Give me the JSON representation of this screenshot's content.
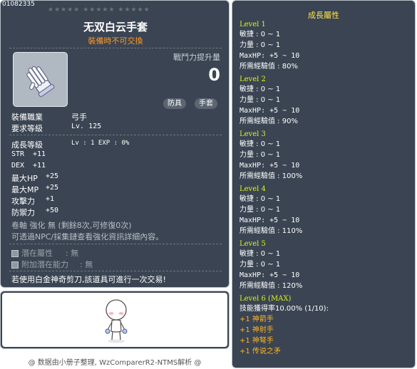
{
  "item": {
    "code": "01082335",
    "stars": "★★★★★ ★★★★★ ★★★★★",
    "name": "无双白云手套",
    "trade_note": "裝備時不可交換",
    "power_label": "戰鬥力提升量",
    "power_value": "0",
    "tags": [
      "防具",
      "手套"
    ],
    "icon": "white-glove-icon",
    "job_label": "裝備職業",
    "job_value": "弓手",
    "req_level_label": "要求等級",
    "req_level_value": "Lv. 125",
    "growth_label": "成長等級",
    "growth_value": "Lv : 1  EXP : 0%",
    "stats": [
      {
        "label": "STR",
        "value": "+11"
      },
      {
        "label": "DEX",
        "value": "+11"
      },
      {
        "label": "最大HP",
        "value": "+25"
      },
      {
        "label": "最大MP",
        "value": "+25"
      },
      {
        "label": "攻擊力",
        "value": "+1"
      },
      {
        "label": "防禦力",
        "value": "+50"
      }
    ],
    "enhance_line1": "卷軸 強化 無 (剩餘8次,可修復0次)",
    "enhance_line2": "可透過NPC/採集鏈查看強化資訊詳細內容。",
    "potential_label": "潛在屬性",
    "potential_value": ": 無",
    "add_potential_label": "附加潛在能力",
    "add_potential_value": ": 無",
    "scissors_note": "若使用白金神奇剪刀,該道具可進行一次交易!"
  },
  "growth": {
    "title": "成長屬性",
    "levels": [
      {
        "title": "Level 1",
        "lines": [
          "敏捷 : 0 ~ 1",
          "力量 : 0 ~ 1",
          "MaxHP:  +5 ~ 10",
          "所需經驗值 : 80%"
        ]
      },
      {
        "title": "Level 2",
        "lines": [
          "敏捷 : 0 ~ 1",
          "力量 : 0 ~ 1",
          "MaxHP:  +5 ~ 10",
          "所需經驗值 : 90%"
        ]
      },
      {
        "title": "Level 3",
        "lines": [
          "敏捷 : 0 ~ 1",
          "力量 : 0 ~ 1",
          "MaxHP:  +5 ~ 10",
          "所需經驗值 : 100%"
        ]
      },
      {
        "title": "Level 4",
        "lines": [
          "敏捷 : 0 ~ 1",
          "力量 : 0 ~ 1",
          "MaxHP:  +5 ~ 10",
          "所需經驗值 : 110%"
        ]
      },
      {
        "title": "Level 5",
        "lines": [
          "敏捷 : 0 ~ 1",
          "力量 : 0 ~ 1",
          "MaxHP:  +5 ~ 10",
          "所需經驗值 : 120%"
        ]
      }
    ],
    "final_title": "Level 6 (MAX)",
    "final_line": "技能獲得率10.00% (1/10):",
    "skills": [
      "+1 神箭手",
      "+1 神射手",
      "+1 神弩手",
      "+1 传说之矛"
    ]
  },
  "footer": {
    "credit": "@ 数据由小册子整理, WzComparerR2-NTMS解析 @"
  }
}
